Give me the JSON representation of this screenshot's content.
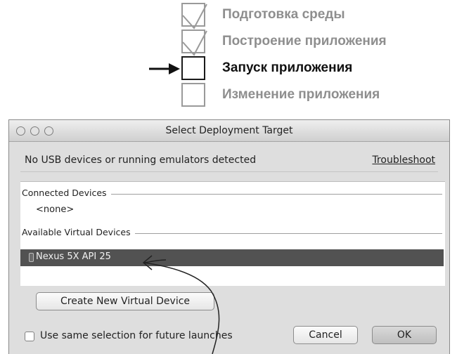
{
  "steps": [
    {
      "label": "Подготовка среды",
      "state": "done"
    },
    {
      "label": "Построение приложения",
      "state": "done"
    },
    {
      "label": "Запуск приложения",
      "state": "current"
    },
    {
      "label": "Изменение приложения",
      "state": "pending"
    }
  ],
  "dialog": {
    "title": "Select Deployment Target",
    "message": "No USB devices or running emulators detected",
    "troubleshoot_link": "Troubleshoot",
    "groups": {
      "connected": {
        "header": "Connected Devices",
        "empty_text": "<none>"
      },
      "available": {
        "header": "Available Virtual Devices",
        "selected_device": "Nexus 5X API 25"
      }
    },
    "create_button": "Create New Virtual Device",
    "checkbox_label": "Use same selection for future launches",
    "cancel_button": "Cancel",
    "ok_button": "OK"
  },
  "colors": {
    "selection": "#525252",
    "done_step_text": "#8e8e8e",
    "current_step_text": "#111111"
  }
}
